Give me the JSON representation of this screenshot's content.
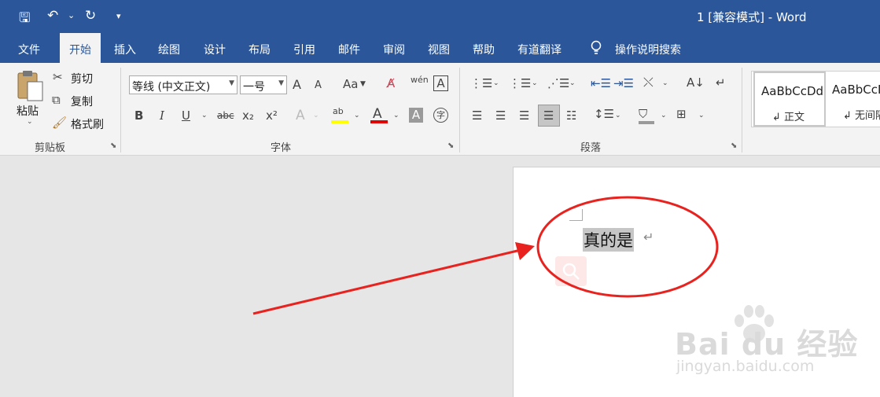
{
  "title": "1 [兼容模式]  -  Word",
  "qat": {
    "save": "🖫",
    "undo": "↶",
    "undo_dd": "⌄",
    "redo": "↻",
    "customize": "▾"
  },
  "tabs": [
    "文件",
    "开始",
    "插入",
    "绘图",
    "设计",
    "布局",
    "引用",
    "邮件",
    "审阅",
    "视图",
    "帮助",
    "有道翻译"
  ],
  "tell_me": "操作说明搜索",
  "clipboard": {
    "paste": "粘贴",
    "cut": "剪切",
    "copy": "复制",
    "format_painter": "格式刷",
    "group": "剪贴板"
  },
  "font": {
    "name": "等线 (中文正文)",
    "size": "一号",
    "group": "字体",
    "bold": "B",
    "italic": "I",
    "underline": "U",
    "strike": "abc",
    "sub": "x₂",
    "sup": "x²",
    "grow": "A",
    "shrink": "A",
    "case": "Aa",
    "phonetic": "wén",
    "border": "A",
    "effects": "A",
    "highlight": "ab",
    "color": "A",
    "shade": "A",
    "enclose": "字"
  },
  "paragraph": {
    "group": "段落"
  },
  "styles": [
    {
      "sample": "AaBbCcDd",
      "name": "↲ 正文"
    },
    {
      "sample": "AaBbCcD",
      "name": "↲ 无间隔"
    }
  ],
  "document": {
    "text": "真的是",
    "mark": "↵"
  },
  "watermark": {
    "logo": "Bai du 经验",
    "url": "jingyan.baidu.com"
  },
  "colors": {
    "accent": "#2b579a",
    "annotation": "#e8231f",
    "highlight": "#ffff00",
    "font_color": "#e00000"
  }
}
